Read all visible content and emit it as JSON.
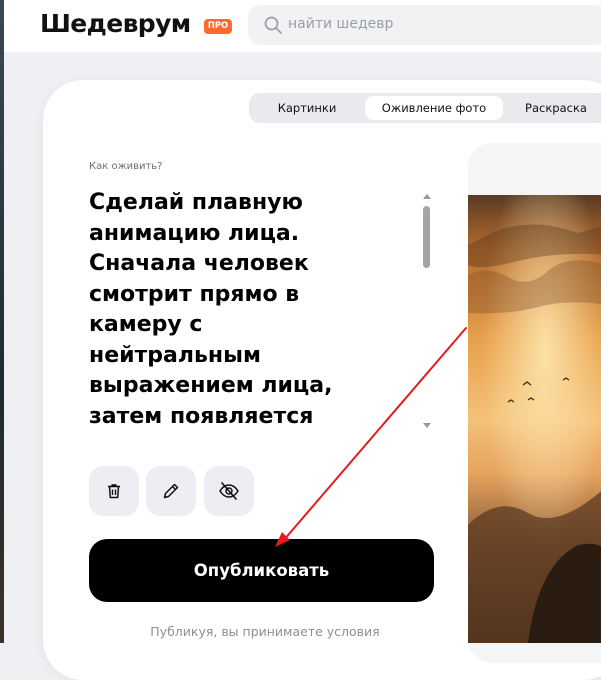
{
  "header": {
    "logo": "Шедеврум",
    "badge": "ПРО",
    "search": {
      "placeholder": "найти шедевр",
      "icon": "search-icon"
    }
  },
  "tabs": [
    {
      "label": "Картинки",
      "active": false
    },
    {
      "label": "Оживление фото",
      "active": true
    },
    {
      "label": "Раскраска",
      "active": false
    }
  ],
  "editor": {
    "how_label": "Как оживить?",
    "prompt_lines": [
      "Сделай плавную",
      "анимацию лица.",
      "Сначала человек",
      "смотрит прямо в",
      "камеру с",
      "нейтральным",
      "выражением лица,",
      "затем появляется"
    ],
    "actions": [
      {
        "icon": "trash-icon"
      },
      {
        "icon": "pencil-icon"
      },
      {
        "icon": "eye-off-icon"
      }
    ],
    "publish_label": "Опубликовать",
    "terms_text": "Публикуя, вы принимаете условия"
  },
  "colors": {
    "accent_badge": "#ff6a2c",
    "publish_bg": "#000000",
    "annotation_arrow": "#e21b1b"
  }
}
